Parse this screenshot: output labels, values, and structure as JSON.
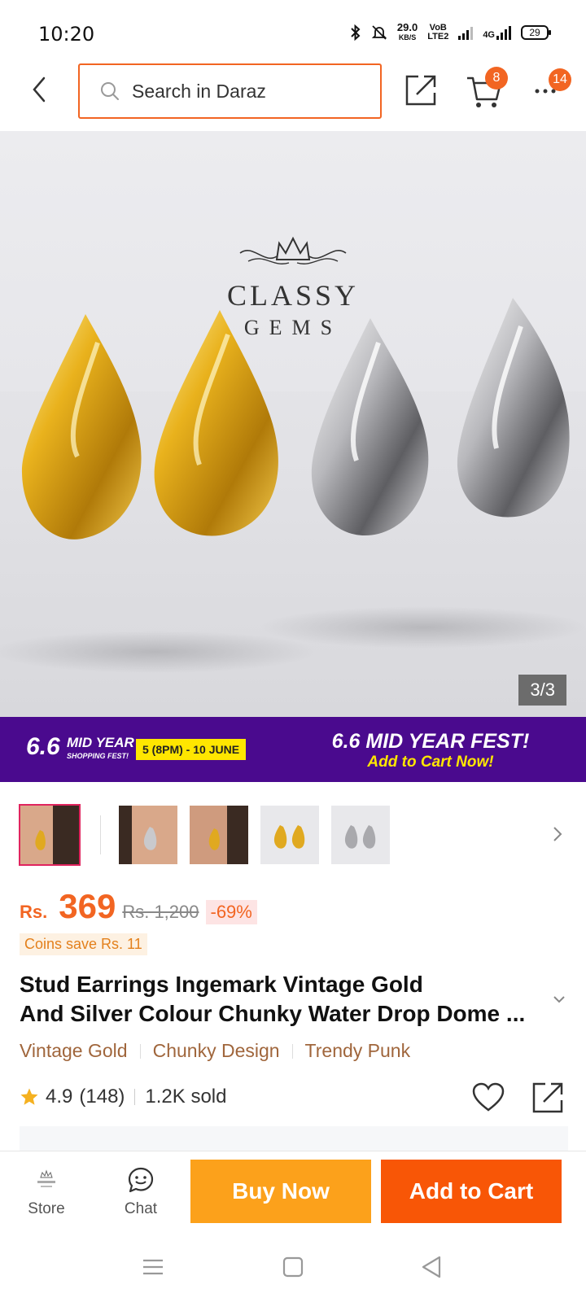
{
  "status_bar": {
    "time": "10:20",
    "net_speed": "29.0",
    "net_unit": "KB/S",
    "volte_top": "VoB",
    "volte_bottom": "LTE2",
    "network": "4G",
    "battery": "29"
  },
  "top_nav": {
    "search_placeholder": "Search in Daraz",
    "cart_badge": "8",
    "more_badge": "14",
    "accent_color": "#f26522"
  },
  "hero": {
    "brand_line1": "CLASSY",
    "brand_line2": "GEMS",
    "image_counter": "3/3"
  },
  "promo": {
    "big": "6.6",
    "mini_line1": "MID YEAR",
    "mini_line2": "SHOPPING FEST!",
    "date": "5 (8PM) - 10 JUNE",
    "right_line1": "6.6 MID YEAR FEST!",
    "right_line2": "Add to Cart Now!",
    "bg_color": "#4a0a8e"
  },
  "product": {
    "currency": "Rs.",
    "price": "369",
    "original_price": "Rs. 1,200",
    "discount": "-69%",
    "coins": "Coins save Rs. 11",
    "title_line1": "Stud Earrings Ingemark Vintage Gold",
    "title_line2": "And Silver Colour Chunky Water Drop Dome ...",
    "tags": [
      "Vintage Gold",
      "Chunky Design",
      "Trendy Punk"
    ],
    "rating": "4.9",
    "rating_count": "(148)",
    "sold": "1.2K sold"
  },
  "action_bar": {
    "store_label": "Store",
    "chat_label": "Chat",
    "buy_now_label": "Buy Now",
    "add_to_cart_label": "Add to Cart",
    "buy_now_color": "#fca11b",
    "add_to_cart_color": "#f85606"
  }
}
